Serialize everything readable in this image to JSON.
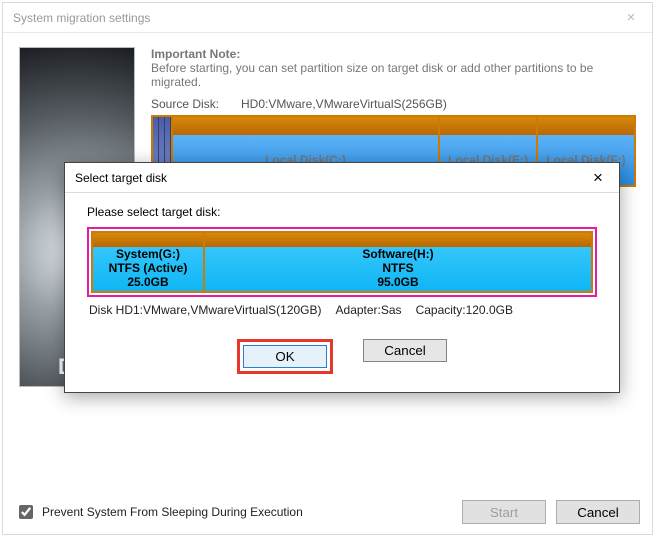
{
  "outer": {
    "title": "System migration settings",
    "noteHead": "Important Note:",
    "noteBody": "Before starting, you can set partition size on target disk or add other partitions to be migrated.",
    "sourceLabel": "Source Disk:",
    "sourceValue": "HD0:VMware,VMwareVirtualS(256GB)",
    "parts": {
      "c": "Local Disk(C:)",
      "e": "Local Disk(E:)",
      "f": "Local Disk(F:)"
    },
    "checkbox": "Prevent System From Sleeping During Execution",
    "start": "Start",
    "cancel": "Cancel"
  },
  "dialog": {
    "title": "Select target disk",
    "instruction": "Please select target disk:",
    "partG": {
      "name": "System(G:)",
      "fs": "NTFS (Active)",
      "size": "25.0GB"
    },
    "partH": {
      "name": "Software(H:)",
      "fs": "NTFS",
      "size": "95.0GB"
    },
    "diskLine": "Disk HD1:VMware,VMwareVirtualS(120GB)",
    "adapter": "Adapter:Sas",
    "capacity": "Capacity:120.0GB",
    "ok": "OK",
    "cancel": "Cancel"
  }
}
